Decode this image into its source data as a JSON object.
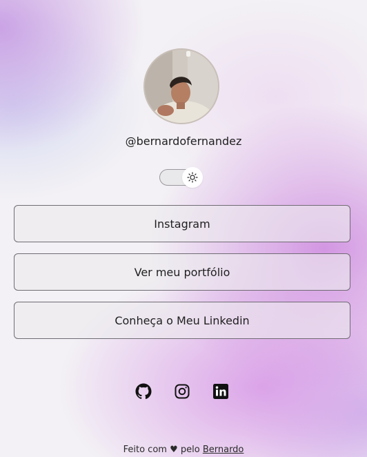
{
  "profile": {
    "username": "@bernardofernandez"
  },
  "theme_toggle": {
    "icon": "sun-icon"
  },
  "links": [
    {
      "label": "Instagram"
    },
    {
      "label": "Ver meu portfólio"
    },
    {
      "label": "Conheça o Meu Linkedin"
    }
  ],
  "social": {
    "icons": [
      "github-icon",
      "instagram-icon",
      "linkedin-icon"
    ]
  },
  "footer": {
    "text_before": "Feito com ",
    "heart": "♥",
    "text_after": " pelo ",
    "author_link": "Bernardo"
  },
  "colors": {
    "background_base": "#f3f1f5",
    "gradient_purple": "#c896e2",
    "button_border": "#6f6b73",
    "text": "#1e1e1e"
  }
}
